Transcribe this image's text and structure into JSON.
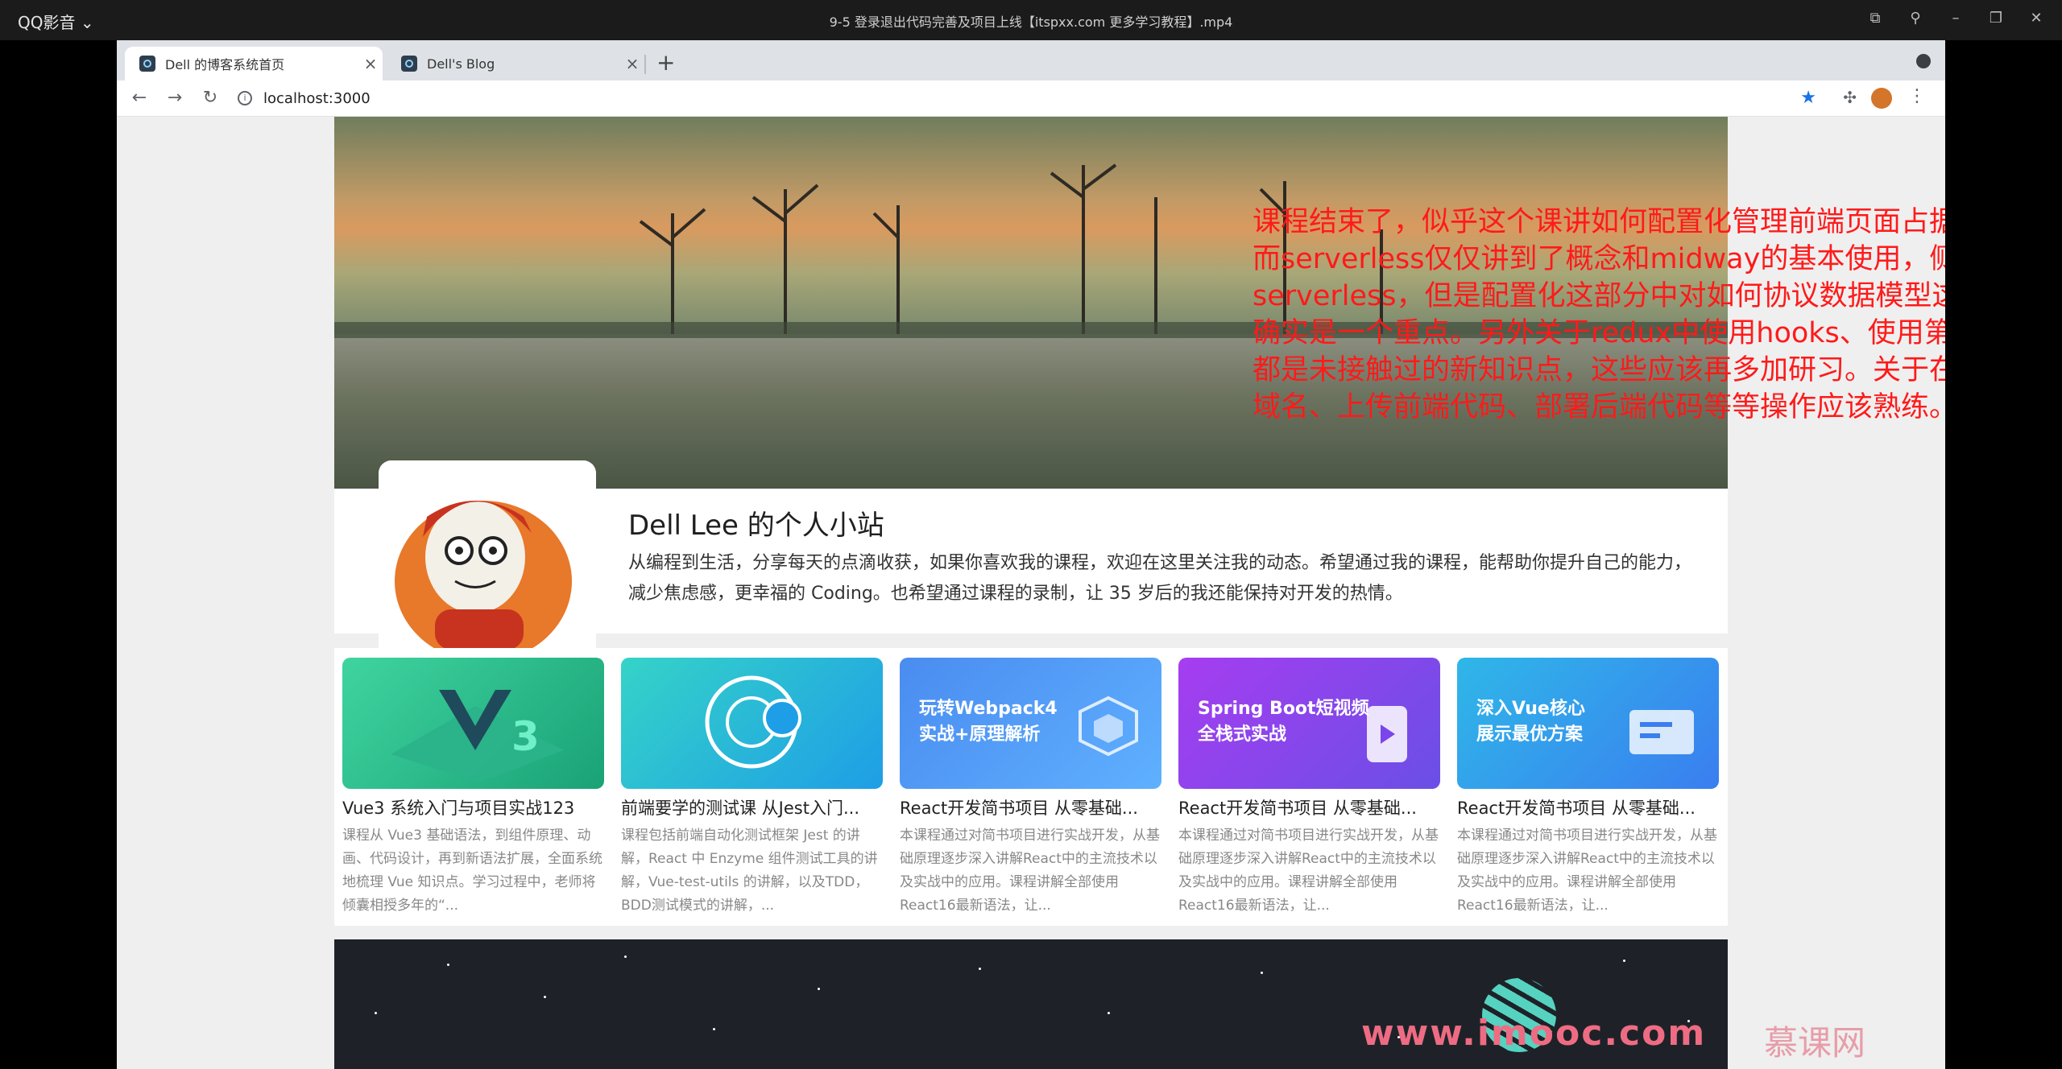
{
  "player": {
    "app_name": "QQ影音",
    "file_title": "9-5 登录退出代码完善及项目上线【itspxx.com  更多学习教程】.mp4"
  },
  "browser": {
    "tabs": [
      {
        "label": "Dell 的博客系统首页",
        "active": true
      },
      {
        "label": "Dell's Blog",
        "active": false
      }
    ],
    "url": "localhost:3000"
  },
  "overlay_note": "课程结束了，似乎这个课讲如何配置化管理前端页面占据了大部分时间，而serverless仅仅讲到了概念和midway的基本使用，侧重点并没有偏向serverless，但是配置化这部分中对如何协议数据模型这块在实际业务中确实是一个重点。另外关于redux中使用hooks、使用第三方Authing，都是未接触过的新知识点，这些应该再多加研习。关于在阿里云平台申请域名、上传前端代码、部署后端代码等等操作应该熟练。",
  "profile": {
    "title": "Dell Lee 的个人小站",
    "description": "从编程到生活，分享每天的点滴收获，如果你喜欢我的课程，欢迎在这里关注我的动态。希望通过我的课程，能帮助你提升自己的能力，减少焦虑感，更幸福的 Coding。也希望通过课程的录制，让 35 岁后的我还能保持对开发的热情。"
  },
  "courses": [
    {
      "thumb_text": "",
      "title": "Vue3 系统入门与项目实战123",
      "desc": "课程从 Vue3 基础语法，到组件原理、动画、代码设计，再到新语法扩展，全面系统地梳理 Vue 知识点。学习过程中，老师将倾囊相授多年的“...",
      "color1": "#3fd4a0",
      "color2": "#1aa276"
    },
    {
      "thumb_text": "",
      "title": "前端要学的测试课 从Jest入门...",
      "desc": "课程包括前端自动化测试框架 Jest 的讲解，React 中 Enzyme 组件测试工具的讲解，Vue-test-utils 的讲解，以及TDD，BDD测试模式的讲解，...",
      "color1": "#35d3c8",
      "color2": "#1e9ee6"
    },
    {
      "thumb_text": "玩转Webpack4\n实战+原理解析",
      "title": "React开发简书项目 从零基础...",
      "desc": "本课程通过对简书项目进行实战开发，从基础原理逐步深入讲解React中的主流技术以及实战中的应用。课程讲解全部使用React16最新语法，让...",
      "color1": "#4a8cf0",
      "color2": "#5fb0ff"
    },
    {
      "thumb_text": "Spring Boot短视频\n全栈式实战",
      "title": "React开发简书项目 从零基础...",
      "desc": "本课程通过对简书项目进行实战开发，从基础原理逐步深入讲解React中的主流技术以及实战中的应用。课程讲解全部使用React16最新语法，让...",
      "color1": "#a63df0",
      "color2": "#6a4fe6"
    },
    {
      "thumb_text": "深入Vue核心\n展示最优方案",
      "title": "React开发简书项目 从零基础...",
      "desc": "本课程通过对简书项目进行实战开发，从基础原理逐步深入讲解React中的主流技术以及实战中的应用。课程讲解全部使用React16最新语法，让...",
      "color1": "#2fb7e8",
      "color2": "#3a7ef0"
    }
  ],
  "watermark": {
    "url": "www.imooc.com",
    "brand": "慕课网"
  }
}
